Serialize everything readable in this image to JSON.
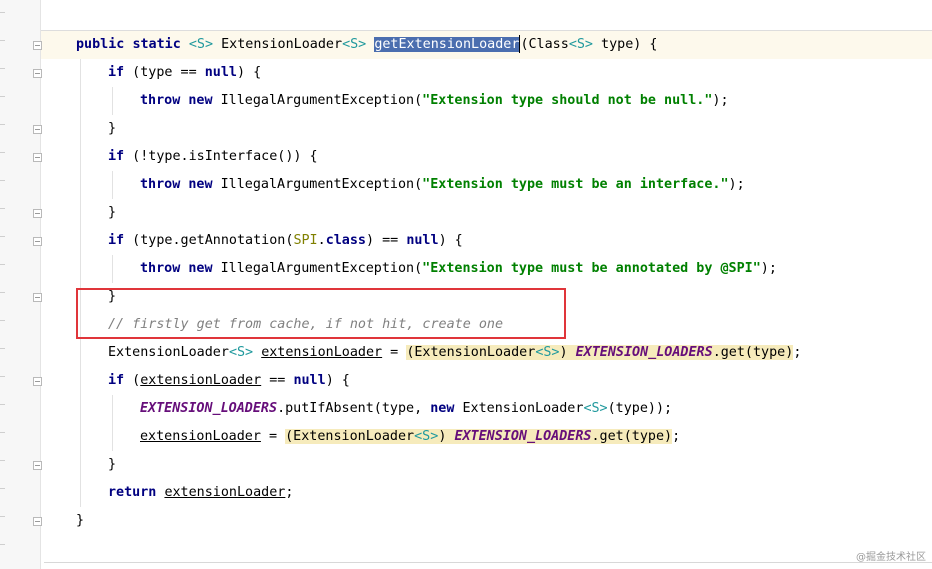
{
  "code_lines": [
    {
      "segments": [
        {
          "t": "public",
          "c": "kw"
        },
        {
          "t": " "
        },
        {
          "t": "static",
          "c": "kw"
        },
        {
          "t": " "
        },
        {
          "t": "<S>",
          "c": "gen"
        },
        {
          "t": " ExtensionLoader"
        },
        {
          "t": "<S>",
          "c": "gen"
        },
        {
          "t": " "
        },
        {
          "t": "getExtensionLoader",
          "c": "sel"
        },
        {
          "t": "",
          "c": "caret"
        },
        {
          "t": "(Class"
        },
        {
          "t": "<S>",
          "c": "gen"
        },
        {
          "t": " type) {"
        }
      ]
    },
    {
      "segments": [
        {
          "t": "if",
          "c": "kw"
        },
        {
          "t": " (type == "
        },
        {
          "t": "null",
          "c": "kw"
        },
        {
          "t": ") {"
        }
      ]
    },
    {
      "segments": [
        {
          "t": "throw",
          "c": "kw"
        },
        {
          "t": " "
        },
        {
          "t": "new",
          "c": "kw"
        },
        {
          "t": " IllegalArgumentException("
        },
        {
          "t": "\"Extension type should not be null.\"",
          "c": "str"
        },
        {
          "t": ");"
        }
      ]
    },
    {
      "segments": [
        {
          "t": "}"
        }
      ]
    },
    {
      "segments": [
        {
          "t": "if",
          "c": "kw"
        },
        {
          "t": " (!type.isInterface()) {"
        }
      ]
    },
    {
      "segments": [
        {
          "t": "throw",
          "c": "kw"
        },
        {
          "t": " "
        },
        {
          "t": "new",
          "c": "kw"
        },
        {
          "t": " IllegalArgumentException("
        },
        {
          "t": "\"Extension type must be an interface.\"",
          "c": "str"
        },
        {
          "t": ");"
        }
      ]
    },
    {
      "segments": [
        {
          "t": "}"
        }
      ]
    },
    {
      "segments": [
        {
          "t": "if",
          "c": "kw"
        },
        {
          "t": " (type.getAnnotation("
        },
        {
          "t": "SPI",
          "c": "annot"
        },
        {
          "t": "."
        },
        {
          "t": "class",
          "c": "kw"
        },
        {
          "t": ") == "
        },
        {
          "t": "null",
          "c": "kw"
        },
        {
          "t": ") {"
        }
      ]
    },
    {
      "segments": [
        {
          "t": "throw",
          "c": "kw"
        },
        {
          "t": " "
        },
        {
          "t": "new",
          "c": "kw"
        },
        {
          "t": " IllegalArgumentException("
        },
        {
          "t": "\"Extension type must be annotated by @SPI\"",
          "c": "str"
        },
        {
          "t": ");"
        }
      ]
    },
    {
      "segments": [
        {
          "t": "}"
        }
      ]
    },
    {
      "segments": [
        {
          "t": "// firstly get from cache, if not hit, create one",
          "c": "cmt"
        }
      ]
    },
    {
      "segments": [
        {
          "t": "ExtensionLoader"
        },
        {
          "t": "<S>",
          "c": "gen"
        },
        {
          "t": " "
        },
        {
          "t": "extensionLoader",
          "c": "field-ref"
        },
        {
          "t": " = "
        },
        {
          "t": "(ExtensionLoader",
          "c": "hl"
        },
        {
          "t": "<S>",
          "c": "gen hl"
        },
        {
          "t": ") ",
          "c": "hl"
        },
        {
          "t": "EXTENSION_LOADERS",
          "c": "static-field hl"
        },
        {
          "t": ".get(type)",
          "c": "hl"
        },
        {
          "t": ";"
        }
      ]
    },
    {
      "segments": [
        {
          "t": "if",
          "c": "kw"
        },
        {
          "t": " ("
        },
        {
          "t": "extensionLoader",
          "c": "field-ref"
        },
        {
          "t": " == "
        },
        {
          "t": "null",
          "c": "kw"
        },
        {
          "t": ") {"
        }
      ]
    },
    {
      "segments": [
        {
          "t": "EXTENSION_LOADERS",
          "c": "static-field"
        },
        {
          "t": ".putIfAbsent(type, "
        },
        {
          "t": "new",
          "c": "kw"
        },
        {
          "t": " ExtensionLoader"
        },
        {
          "t": "<S>",
          "c": "gen"
        },
        {
          "t": "(type));"
        }
      ]
    },
    {
      "segments": [
        {
          "t": "extensionLoader",
          "c": "field-ref"
        },
        {
          "t": " = "
        },
        {
          "t": "(ExtensionLoader",
          "c": "hl"
        },
        {
          "t": "<S>",
          "c": "gen hl"
        },
        {
          "t": ") ",
          "c": "hl"
        },
        {
          "t": "EXTENSION_LOADERS",
          "c": "static-field hl"
        },
        {
          "t": ".get(type)",
          "c": "hl"
        },
        {
          "t": ";"
        }
      ]
    },
    {
      "segments": [
        {
          "t": "}"
        }
      ]
    },
    {
      "segments": [
        {
          "t": "return",
          "c": "kw"
        },
        {
          "t": " "
        },
        {
          "t": "extensionLoader",
          "c": "field-ref"
        },
        {
          "t": ";"
        }
      ]
    },
    {
      "segments": [
        {
          "t": "}"
        }
      ]
    }
  ],
  "watermark": "@掘金技术社区",
  "colors": {
    "keyword": "#000080",
    "string": "#008000",
    "comment": "#808080",
    "static_field": "#660e7a",
    "selection": "#4b6eaf",
    "highlight": "#f6ebbc",
    "annotation_box": "#e0353a"
  }
}
